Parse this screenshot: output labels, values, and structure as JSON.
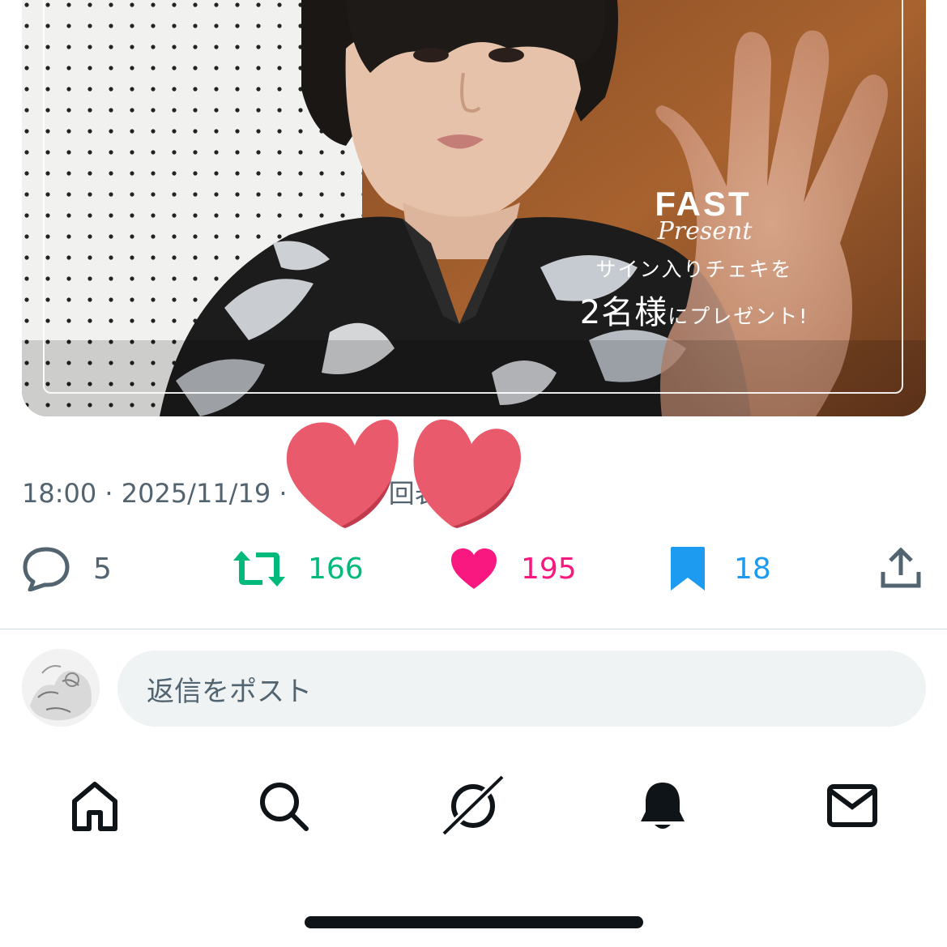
{
  "media": {
    "brand": "FAST",
    "brand_sub": "Present",
    "promo_line1": "サイン入りチェキを",
    "promo_line2_big": "2名様",
    "promo_line2_small": "にプレゼント!"
  },
  "meta": {
    "time": "18:00",
    "separator": " · ",
    "date": "2025/11/19",
    "views_fragment": "回表"
  },
  "actions": {
    "replies": "5",
    "retweets": "166",
    "likes": "195",
    "bookmarks": "18"
  },
  "reply": {
    "placeholder": "返信をポスト"
  },
  "tabs": [
    "home-icon",
    "search-icon",
    "grok-icon",
    "notifications-icon",
    "messages-icon"
  ],
  "colors": {
    "muted": "#536471",
    "retweet_active": "#00ba7c",
    "like_active": "#f91880",
    "bookmark_active": "#1d9bf0",
    "text": "#0f1419",
    "sticker_heart": "#e85a6c"
  }
}
